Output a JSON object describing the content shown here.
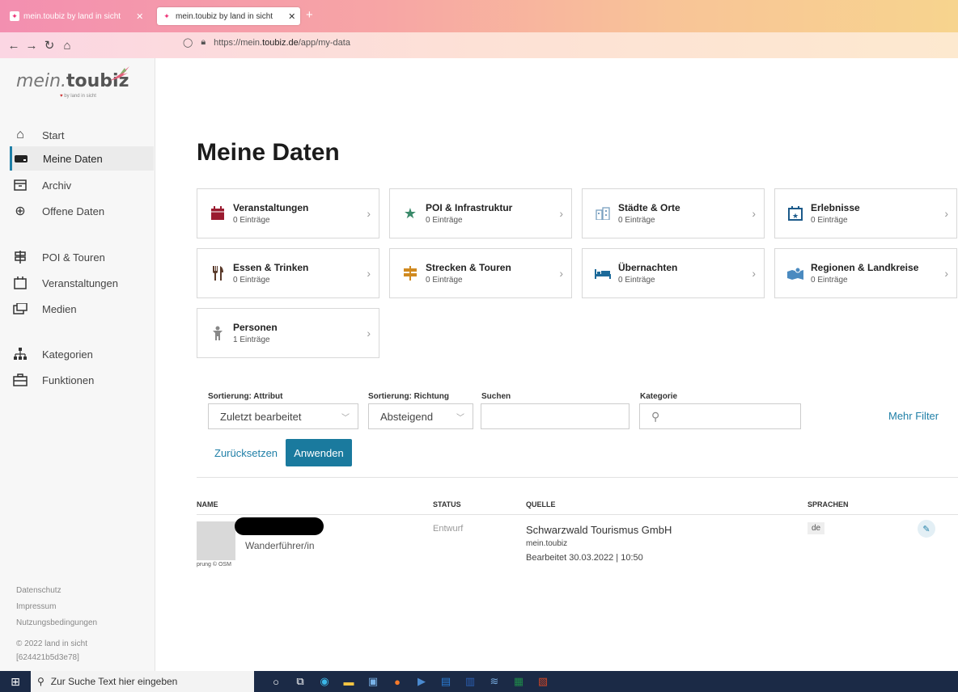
{
  "browser": {
    "tabs": [
      {
        "title": "mein.toubiz by land in sicht"
      },
      {
        "title": "mein.toubiz by land in sicht"
      }
    ],
    "url_prefix": "https://mein.",
    "url_domain": "toubiz.de",
    "url_path": "/app/my-data"
  },
  "sidebar": {
    "logo_main": "mein.",
    "logo_bold": "toubiz",
    "logo_sub": "by land in sicht",
    "items": [
      {
        "label": "Start",
        "icon": "home-icon"
      },
      {
        "label": "Meine Daten",
        "icon": "drive-icon"
      },
      {
        "label": "Archiv",
        "icon": "archive-icon"
      },
      {
        "label": "Offene Daten",
        "icon": "globe-icon"
      },
      {
        "label": "POI & Touren",
        "icon": "signpost-icon"
      },
      {
        "label": "Veranstaltungen",
        "icon": "calendar-icon"
      },
      {
        "label": "Medien",
        "icon": "media-icon"
      },
      {
        "label": "Kategorien",
        "icon": "hierarchy-icon"
      },
      {
        "label": "Funktionen",
        "icon": "toolbox-icon"
      }
    ],
    "footer": [
      "Datenschutz",
      "Impressum",
      "Nutzungsbedingungen",
      "© 2022 land in sicht",
      "[624421b5d3e78]"
    ]
  },
  "main": {
    "title": "Meine Daten",
    "cards": [
      {
        "title": "Veranstaltungen",
        "count": "0 Einträge",
        "icon": "calendar-filled-icon",
        "color": "#9b1b30"
      },
      {
        "title": "POI & Infrastruktur",
        "count": "0 Einträge",
        "icon": "star-icon",
        "color": "#3a8a6a"
      },
      {
        "title": "Städte & Orte",
        "count": "0 Einträge",
        "icon": "buildings-icon",
        "color": "#7aa0c0"
      },
      {
        "title": "Erlebnisse",
        "count": "0 Einträge",
        "icon": "calendar-star-icon",
        "color": "#1c5a8a"
      },
      {
        "title": "Essen & Trinken",
        "count": "0 Einträge",
        "icon": "cutlery-icon",
        "color": "#5a3a2a"
      },
      {
        "title": "Strecken & Touren",
        "count": "0 Einträge",
        "icon": "signpost-icon",
        "color": "#d08a20"
      },
      {
        "title": "Übernachten",
        "count": "0 Einträge",
        "icon": "bed-icon",
        "color": "#1c6a9a"
      },
      {
        "title": "Regionen & Landkreise",
        "count": "0 Einträge",
        "icon": "map-icon",
        "color": "#4a8ac0"
      },
      {
        "title": "Personen",
        "count": "1 Einträge",
        "icon": "person-icon",
        "color": "#888888"
      }
    ],
    "filters": {
      "sort_attr_label": "Sortierung: Attribut",
      "sort_attr_value": "Zuletzt bearbeitet",
      "sort_dir_label": "Sortierung: Richtung",
      "sort_dir_value": "Absteigend",
      "search_label": "Suchen",
      "category_label": "Kategorie",
      "more_filters": "Mehr Filter",
      "reset": "Zurücksetzen",
      "apply": "Anwenden"
    },
    "table": {
      "headers": [
        "NAME",
        "STATUS",
        "QUELLE",
        "SPRACHEN"
      ],
      "rows": [
        {
          "subtitle": "Wanderführer/in",
          "thumb_caption": "prung © OSM",
          "status": "Entwurf",
          "source": "Schwarzwald Tourismus GmbH",
          "source_sub": "mein.toubiz",
          "edited": "Bearbeitet 30.03.2022 | 10:50",
          "language": "de"
        }
      ]
    }
  },
  "taskbar": {
    "search_placeholder": "Zur Suche Text hier eingeben"
  }
}
